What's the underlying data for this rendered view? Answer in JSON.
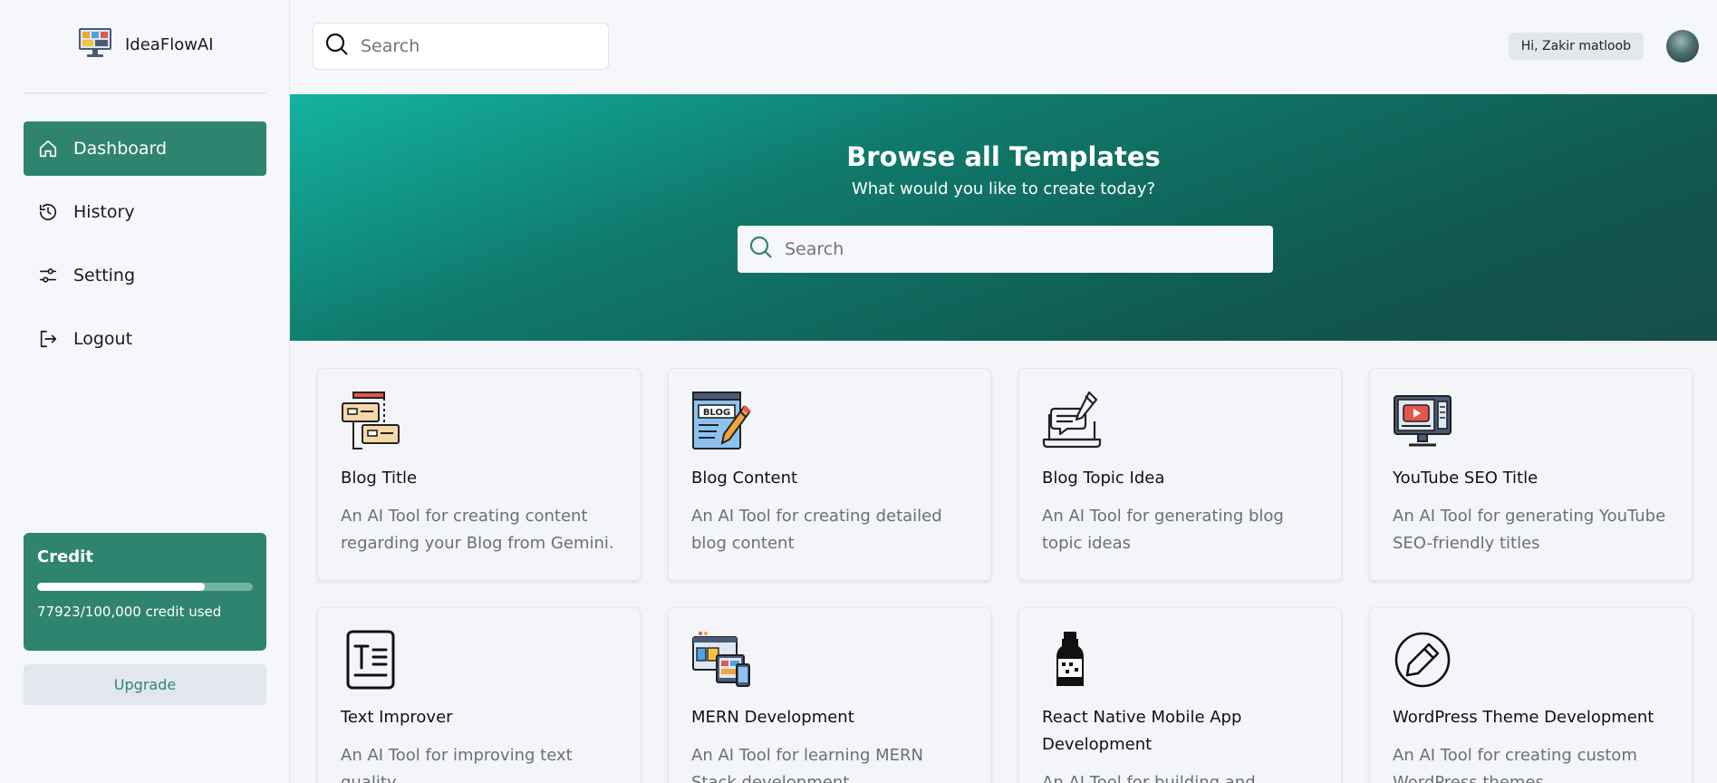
{
  "app": {
    "brand": "IdeaFlowAI"
  },
  "sidebar": {
    "items": [
      {
        "label": "Dashboard",
        "icon": "home-icon",
        "active": true
      },
      {
        "label": "History",
        "icon": "history-icon"
      },
      {
        "label": "Setting",
        "icon": "settings-sliders-icon"
      },
      {
        "label": "Logout",
        "icon": "logout-icon"
      }
    ],
    "credit": {
      "title": "Credit",
      "used": 77923,
      "total": 100000,
      "label": "77923/100,000 credit used"
    },
    "upgrade_label": "Upgrade"
  },
  "header": {
    "search_placeholder": "Search",
    "greeting": "Hi, Zakir matloob"
  },
  "hero": {
    "title": "Browse all Templates",
    "subtitle": "What would you like to create today?",
    "search_placeholder": "Search"
  },
  "templates": [
    {
      "title": "Blog Title",
      "desc": "An AI Tool for creating content regarding your Blog from Gemini.",
      "icon": "blog-title-icon"
    },
    {
      "title": "Blog Content",
      "desc": "An AI Tool for creating detailed blog content",
      "icon": "blog-content-icon"
    },
    {
      "title": "Blog Topic Idea",
      "desc": "An AI Tool for generating blog topic ideas",
      "icon": "blog-topic-icon"
    },
    {
      "title": "YouTube SEO Title",
      "desc": "An AI Tool for generating YouTube SEO-friendly titles",
      "icon": "youtube-icon"
    },
    {
      "title": "Text Improver",
      "desc": "An AI Tool for improving text quality",
      "icon": "text-icon"
    },
    {
      "title": "MERN Development",
      "desc": "An AI Tool for learning MERN Stack development",
      "icon": "devices-icon"
    },
    {
      "title": "React Native Mobile App Development",
      "desc": "An AI Tool for building and",
      "icon": "bottle-icon"
    },
    {
      "title": "WordPress Theme Development",
      "desc": "An AI Tool for creating custom WordPress themes",
      "icon": "pencil-circle-icon"
    }
  ],
  "colors": {
    "accent": "#2f8470",
    "hero_start": "#13b3a0",
    "hero_end": "#174e49"
  }
}
